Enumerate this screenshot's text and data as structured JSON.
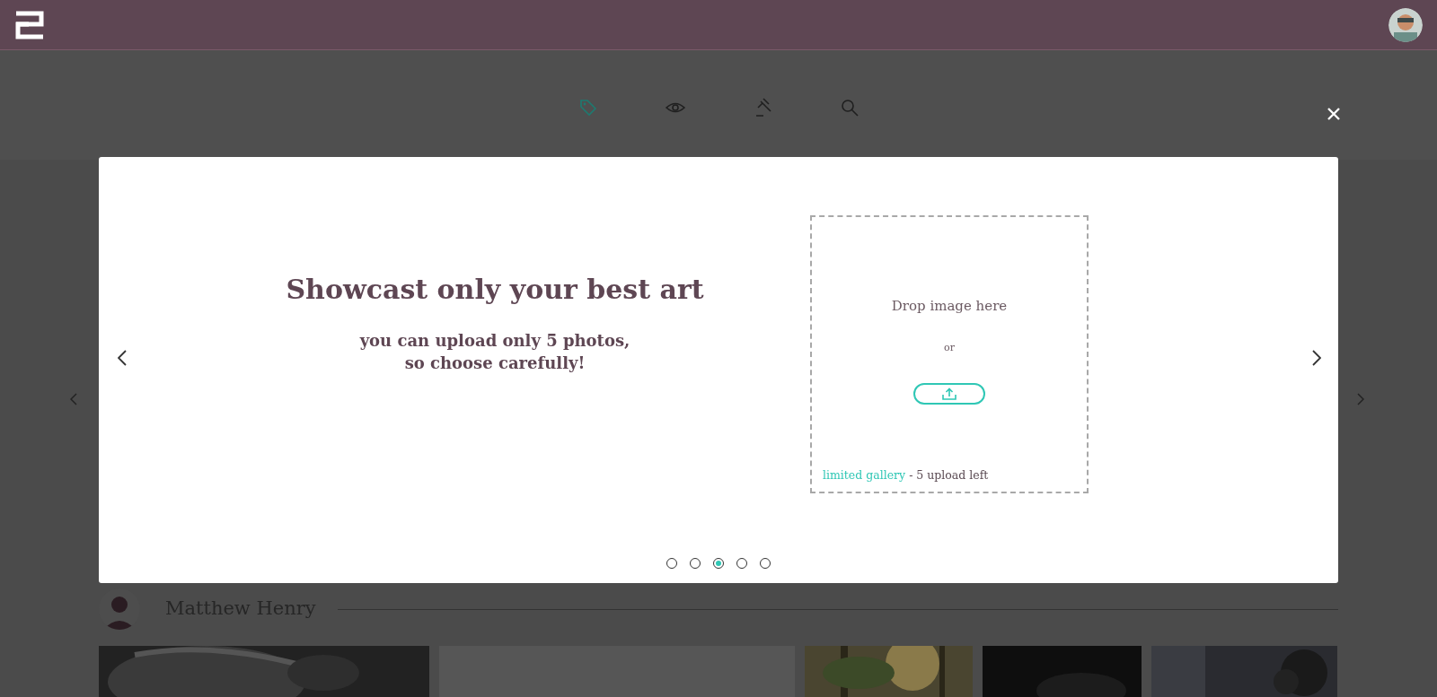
{
  "toolbar": [
    {
      "kind": "tag",
      "selected": true
    },
    {
      "kind": "eye",
      "selected": false
    },
    {
      "kind": "gavel",
      "selected": false
    },
    {
      "kind": "search",
      "selected": false
    }
  ],
  "slide": {
    "title": "Showcast only your best art",
    "subtitle_lines": [
      "you can upload only 5 photos,",
      "so choose carefully!"
    ]
  },
  "dropzone": {
    "prompt": "Drop image here",
    "separator": "or",
    "note_link": "limited gallery",
    "note": "- 5 upload left"
  },
  "dots": [
    {
      "selected": false
    },
    {
      "selected": false
    },
    {
      "selected": true
    },
    {
      "selected": false
    },
    {
      "selected": false
    }
  ],
  "author": {
    "name": "Matthew Henry"
  },
  "gallery": [
    {
      "kind": "picture"
    },
    {
      "kind": "blank"
    },
    {
      "kind": "picture"
    },
    {
      "kind": "picture"
    },
    {
      "kind": "picture"
    }
  ]
}
